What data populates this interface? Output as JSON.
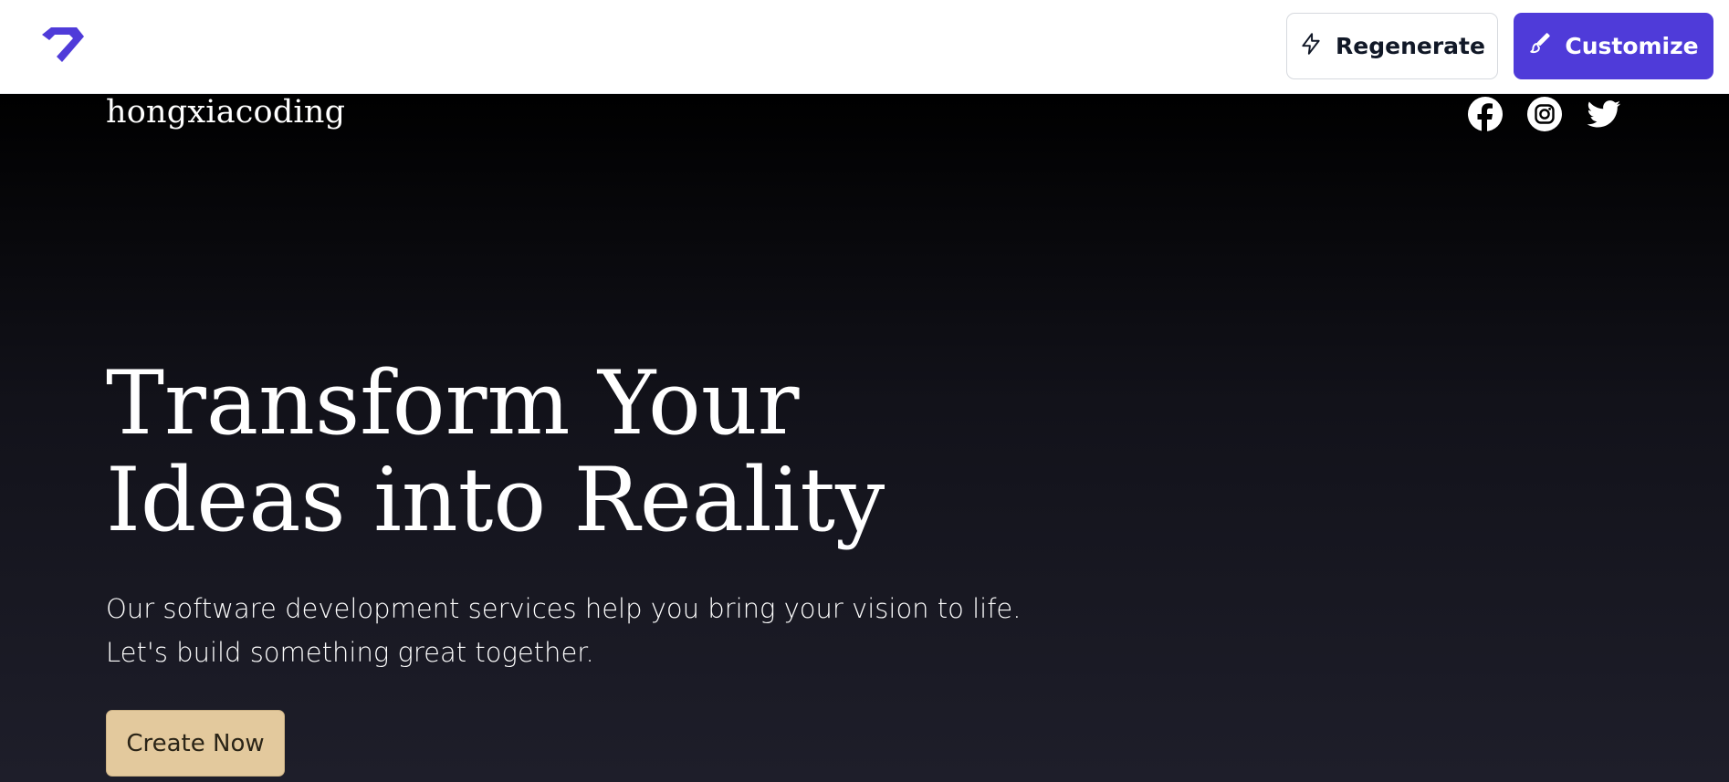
{
  "toolbar": {
    "logo_icon": "diamond-logo-icon",
    "regenerate_label": "Regenerate",
    "regenerate_icon": "lightning-icon",
    "customize_label": "Customize",
    "customize_icon": "paintbrush-icon",
    "accent_color": "#4f3bd9"
  },
  "site": {
    "brand": "hongxiacoding",
    "social": [
      "facebook-icon",
      "instagram-icon",
      "twitter-icon"
    ],
    "hero": {
      "title_line1": "Transform Your",
      "title_line2": "Ideas into Reality",
      "subtitle_line1": "Our software development services help you bring your vision to life.",
      "subtitle_line2": "Let's build something great together.",
      "cta_label": "Create Now",
      "cta_color": "#e3c99d"
    }
  }
}
